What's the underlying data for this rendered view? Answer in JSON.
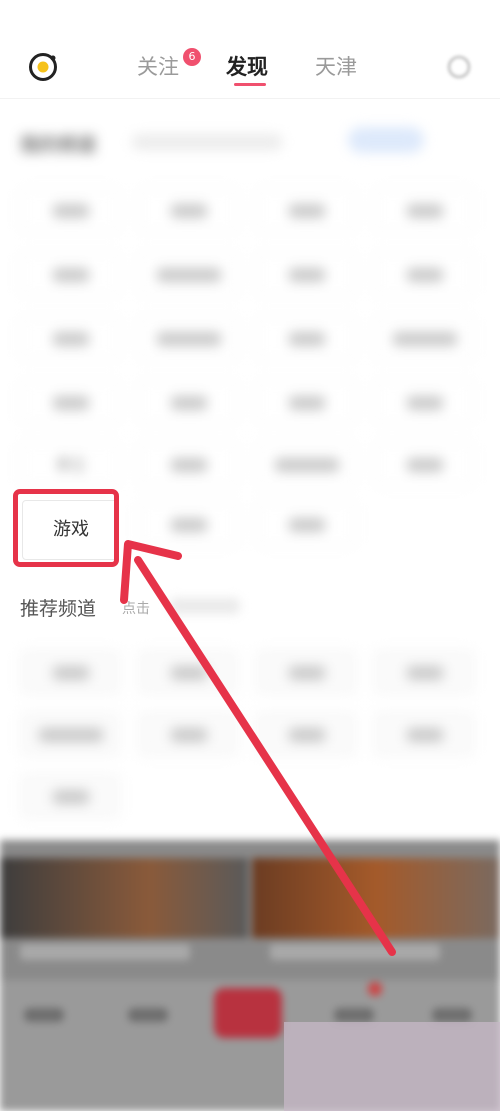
{
  "header": {
    "tabs": [
      {
        "label": "关注",
        "badge": "6"
      },
      {
        "label": "发现"
      },
      {
        "label": "天津"
      }
    ],
    "active_tab": "发现",
    "icons": {
      "logo": "camera-logo-icon",
      "search": "search-icon"
    }
  },
  "channels": {
    "my_channels_title": "我的频道",
    "visible_chip_labels": {
      "handcraft": "手工",
      "game": "游戏"
    },
    "recommended_title": "推荐频道",
    "recommended_hint": "点击"
  },
  "annotation": {
    "color": "#e63349"
  }
}
